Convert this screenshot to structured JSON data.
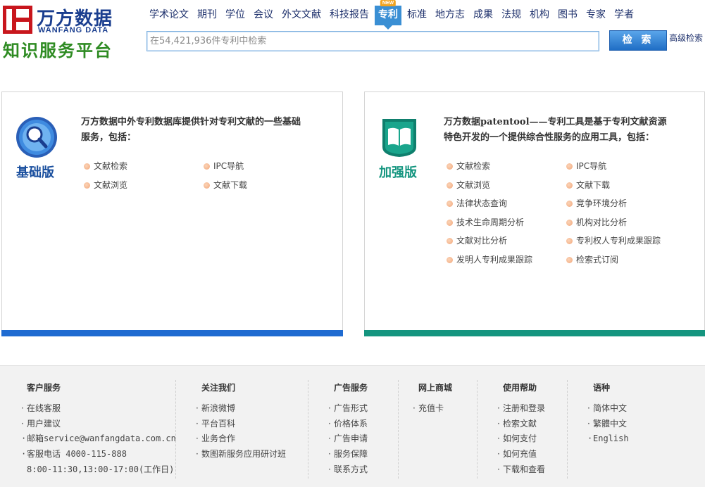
{
  "header": {
    "logo_text": "万方数据",
    "logo_subtext": "WANFANG DATA",
    "slogan": "知识服务平台",
    "nav": [
      {
        "label": "学术论文"
      },
      {
        "label": "期刊"
      },
      {
        "label": "学位"
      },
      {
        "label": "会议"
      },
      {
        "label": "外文文献"
      },
      {
        "label": "科技报告"
      },
      {
        "label": "专利",
        "active": true,
        "badge": "NEW"
      },
      {
        "label": "标准"
      },
      {
        "label": "地方志"
      },
      {
        "label": "成果"
      },
      {
        "label": "法规"
      },
      {
        "label": "机构"
      },
      {
        "label": "图书"
      },
      {
        "label": "专家"
      },
      {
        "label": "学者"
      }
    ],
    "search": {
      "placeholder": "在54,421,936件专利中检索",
      "value": "",
      "button_label": "检 索",
      "advanced_label": "高级检索"
    }
  },
  "panels": {
    "basic": {
      "title": "基础版",
      "icon": "magnifier-icon",
      "description": "万方数据中外专利数据库提供针对专利文献的一些基础服务，包括：",
      "features": [
        "文献检索",
        "IPC导航",
        "文献浏览",
        "文献下载"
      ],
      "accent_color": "#1f6bd1"
    },
    "plus": {
      "title": "加强版",
      "icon": "book-icon",
      "description": "万方数据patentool——专利工具是基于专利文献资源特色开发的一个提供综合性服务的应用工具，包括：",
      "features": [
        "文献检索",
        "IPC导航",
        "文献浏览",
        "文献下载",
        "法律状态查询",
        "竞争环境分析",
        "技术生命周期分析",
        "机构对比分析",
        "文献对比分析",
        "专利权人专利成果跟踪",
        "发明人专利成果跟踪",
        "检索式订阅"
      ],
      "accent_color": "#14957f"
    }
  },
  "footer": {
    "columns": [
      {
        "title": "客户服务",
        "items": [
          "在线客服",
          "用户建议",
          "邮箱service@wanfangdata.com.cn",
          "客服电话 4000-115-888"
        ],
        "note": "8:00-11:30,13:00-17:00(工作日)"
      },
      {
        "title": "关注我们",
        "items": [
          "新浪微博",
          "平台百科",
          "业务合作",
          "数图新服务应用研讨班"
        ]
      },
      {
        "title": "广告服务",
        "items": [
          "广告形式",
          "价格体系",
          "广告申请",
          "服务保障",
          "联系方式"
        ]
      },
      {
        "title": "网上商城",
        "items": [
          "充值卡"
        ]
      },
      {
        "title": "使用帮助",
        "items": [
          "注册和登录",
          "检索文献",
          "如何支付",
          "如何充值",
          "下载和查看"
        ]
      },
      {
        "title": "语种",
        "items": [
          "简体中文",
          "繁體中文",
          "English"
        ]
      }
    ]
  }
}
